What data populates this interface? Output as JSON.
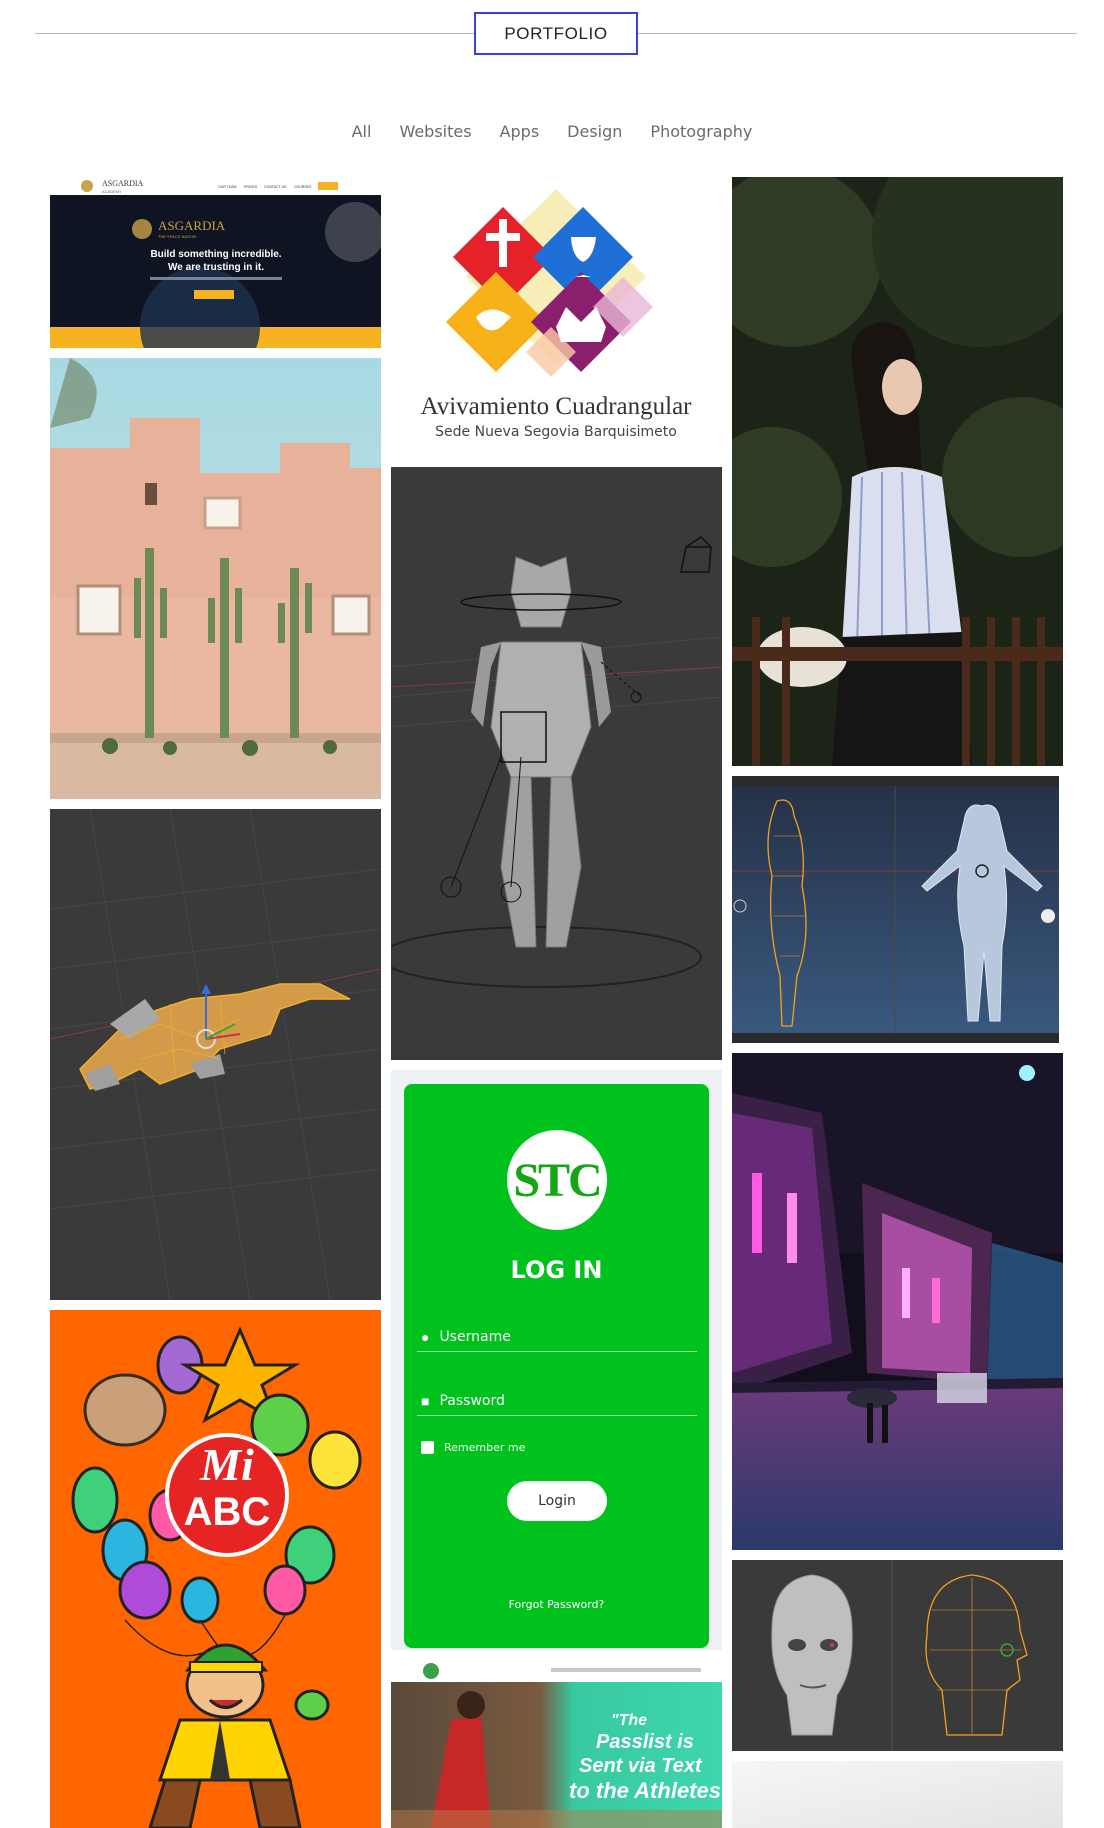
{
  "header": {
    "title": "PORTFOLIO"
  },
  "filters": [
    "All",
    "Websites",
    "Apps",
    "Design",
    "Photography"
  ],
  "asgardia": {
    "brand": "ASGARDIA",
    "brand_sub": "ACADEMY",
    "hero_brand": "ASGARDIA",
    "hero_tag": "THE SPACE NATION",
    "headline1": "Build something incredible.",
    "headline2": "We are trusting in it.",
    "nav": [
      "OUR TEAM",
      "PRICES",
      "CONTACT US",
      "COURSES"
    ]
  },
  "church": {
    "name": "Avivamiento Cuadrangular",
    "sub": "Sede Nueva Segovia Barquisimeto"
  },
  "login": {
    "logo": "STC",
    "title": "LOG IN",
    "username": "Username",
    "password": "Password",
    "remember": "Remember me",
    "button": "Login",
    "forgot": "Forgot Password?"
  },
  "miabc": {
    "line1": "Mi",
    "line2": "ABC"
  },
  "passlist": {
    "q1": "\"The",
    "q2": "Passlist is",
    "q3": "Sent via Text",
    "q4": "to the Athletes\""
  }
}
